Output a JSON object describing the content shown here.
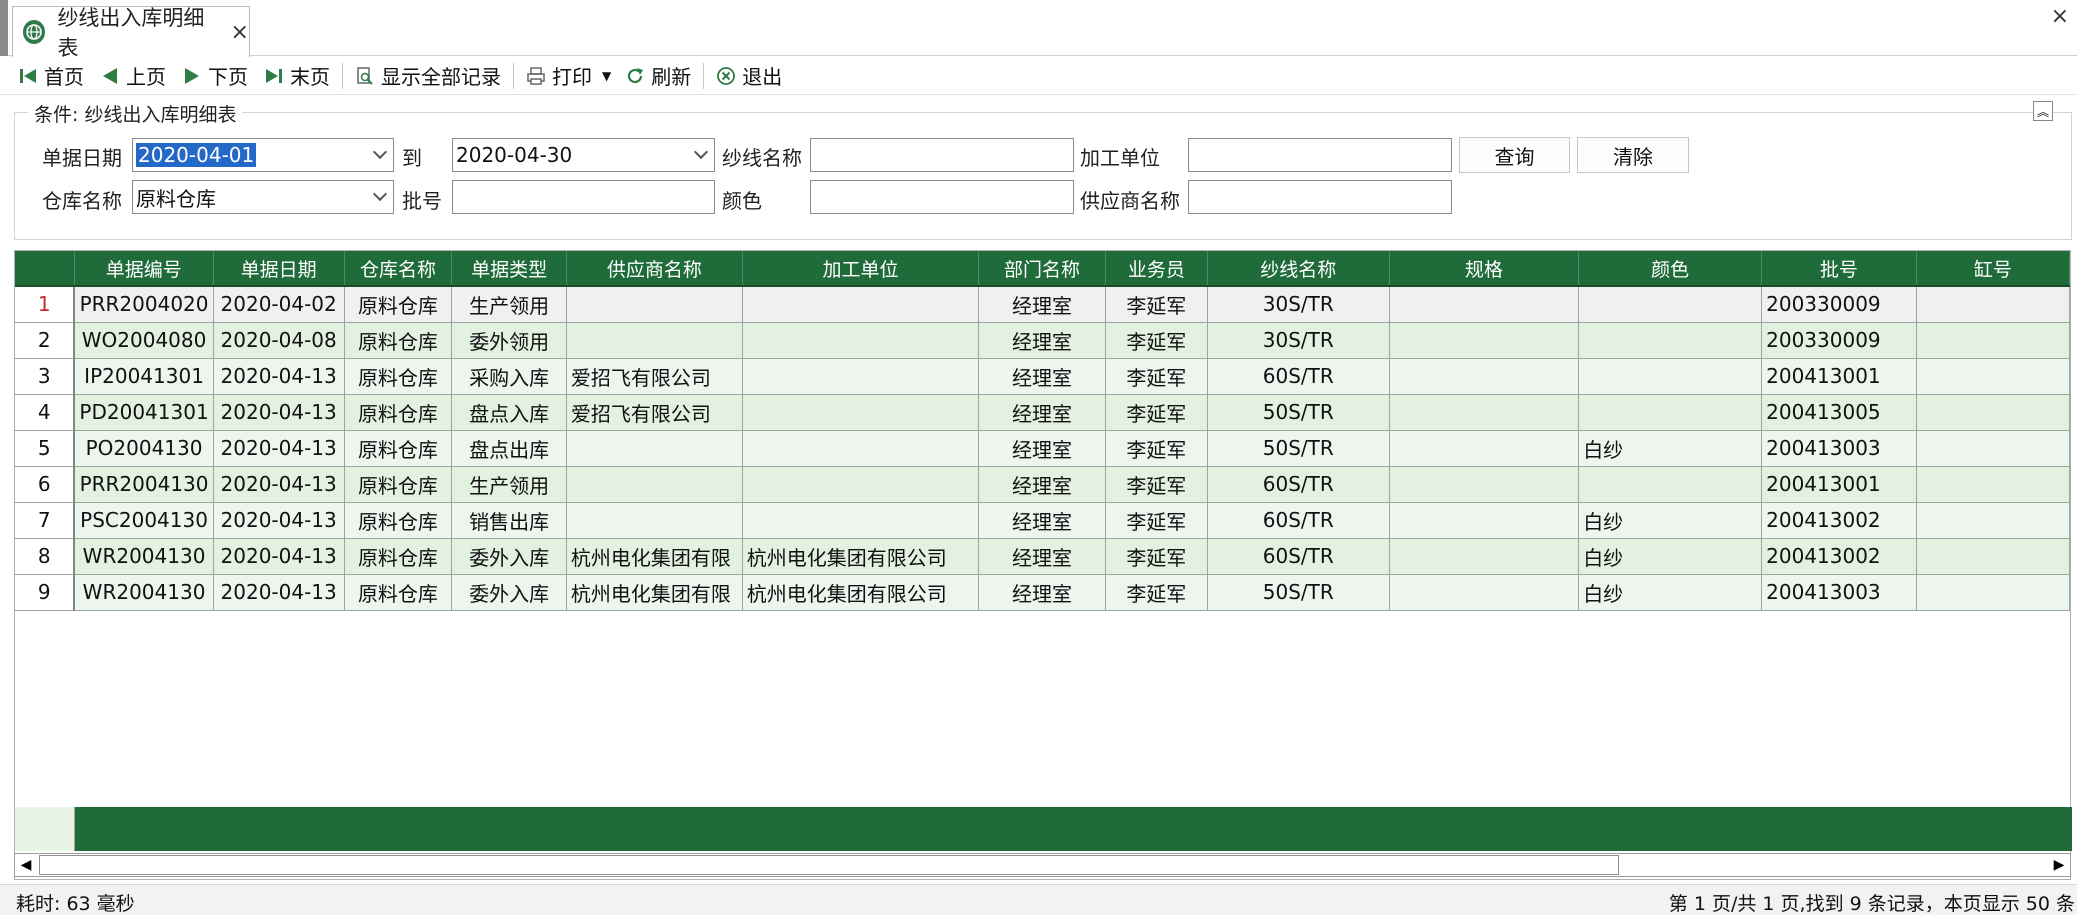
{
  "tab": {
    "title": "纱线出入库明细表",
    "close": "×"
  },
  "window": {
    "close": "×"
  },
  "toolbar": {
    "first": "首页",
    "prev": "上页",
    "next": "下页",
    "last": "末页",
    "show_all": "显示全部记录",
    "print": "打印",
    "refresh": "刷新",
    "exit": "退出"
  },
  "conditions": {
    "legend": "条件: 纱线出入库明细表",
    "date_label": "单据日期",
    "date_from": "2020-04-01",
    "to_label": "到",
    "date_to": "2020-04-30",
    "yarn_label": "纱线名称",
    "yarn_value": "",
    "processor_label": "加工单位",
    "processor_value": "",
    "warehouse_label": "仓库名称",
    "warehouse_value": "原料仓库",
    "batch_label": "批号",
    "batch_value": "",
    "color_label": "颜色",
    "color_value": "",
    "supplier_label": "供应商名称",
    "supplier_value": "",
    "query_button": "查询",
    "clear_button": "清除"
  },
  "grid": {
    "columns": [
      "单据编号",
      "单据日期",
      "仓库名称",
      "单据类型",
      "供应商名称",
      "加工单位",
      "部门名称",
      "业务员",
      "纱线名称",
      "规格",
      "颜色",
      "批号",
      "缸号"
    ],
    "rows": [
      {
        "n": "1",
        "cells": [
          "PRR2004020",
          "2020-04-02",
          "原料仓库",
          "生产领用",
          "",
          "",
          "经理室",
          "李延军",
          "30S/TR",
          "",
          "",
          "200330009",
          ""
        ]
      },
      {
        "n": "2",
        "cells": [
          "WO2004080",
          "2020-04-08",
          "原料仓库",
          "委外领用",
          "",
          "",
          "经理室",
          "李延军",
          "30S/TR",
          "",
          "",
          "200330009",
          ""
        ]
      },
      {
        "n": "3",
        "cells": [
          "IP20041301",
          "2020-04-13",
          "原料仓库",
          "采购入库",
          "爱招飞有限公司",
          "",
          "经理室",
          "李延军",
          "60S/TR",
          "",
          "",
          "200413001",
          ""
        ]
      },
      {
        "n": "4",
        "cells": [
          "PD20041301",
          "2020-04-13",
          "原料仓库",
          "盘点入库",
          "爱招飞有限公司",
          "",
          "经理室",
          "李延军",
          "50S/TR",
          "",
          "",
          "200413005",
          ""
        ]
      },
      {
        "n": "5",
        "cells": [
          "PO2004130",
          "2020-04-13",
          "原料仓库",
          "盘点出库",
          "",
          "",
          "经理室",
          "李延军",
          "50S/TR",
          "",
          "白纱",
          "200413003",
          ""
        ]
      },
      {
        "n": "6",
        "cells": [
          "PRR2004130",
          "2020-04-13",
          "原料仓库",
          "生产领用",
          "",
          "",
          "经理室",
          "李延军",
          "60S/TR",
          "",
          "",
          "200413001",
          ""
        ]
      },
      {
        "n": "7",
        "cells": [
          "PSC2004130",
          "2020-04-13",
          "原料仓库",
          "销售出库",
          "",
          "",
          "经理室",
          "李延军",
          "60S/TR",
          "",
          "白纱",
          "200413002",
          ""
        ]
      },
      {
        "n": "8",
        "cells": [
          "WR2004130",
          "2020-04-13",
          "原料仓库",
          "委外入库",
          "杭州电化集团有限",
          "杭州电化集团有限公司",
          "经理室",
          "李延军",
          "60S/TR",
          "",
          "白纱",
          "200413002",
          ""
        ]
      },
      {
        "n": "9",
        "cells": [
          "WR2004130",
          "2020-04-13",
          "原料仓库",
          "委外入库",
          "杭州电化集团有限",
          "杭州电化集团有限公司",
          "经理室",
          "李延军",
          "50S/TR",
          "",
          "白纱",
          "200413003",
          ""
        ]
      }
    ]
  },
  "status": {
    "elapsed": "耗时: 63 毫秒",
    "paging": "第 1 页/共 1 页,找到 9 条记录，本页显示 50 条"
  },
  "colors": {
    "header_green": "#1f6b3a",
    "row_green": "#e3f1e1",
    "selection_blue": "#2468c8",
    "row_marker_red": "#c8272f"
  }
}
